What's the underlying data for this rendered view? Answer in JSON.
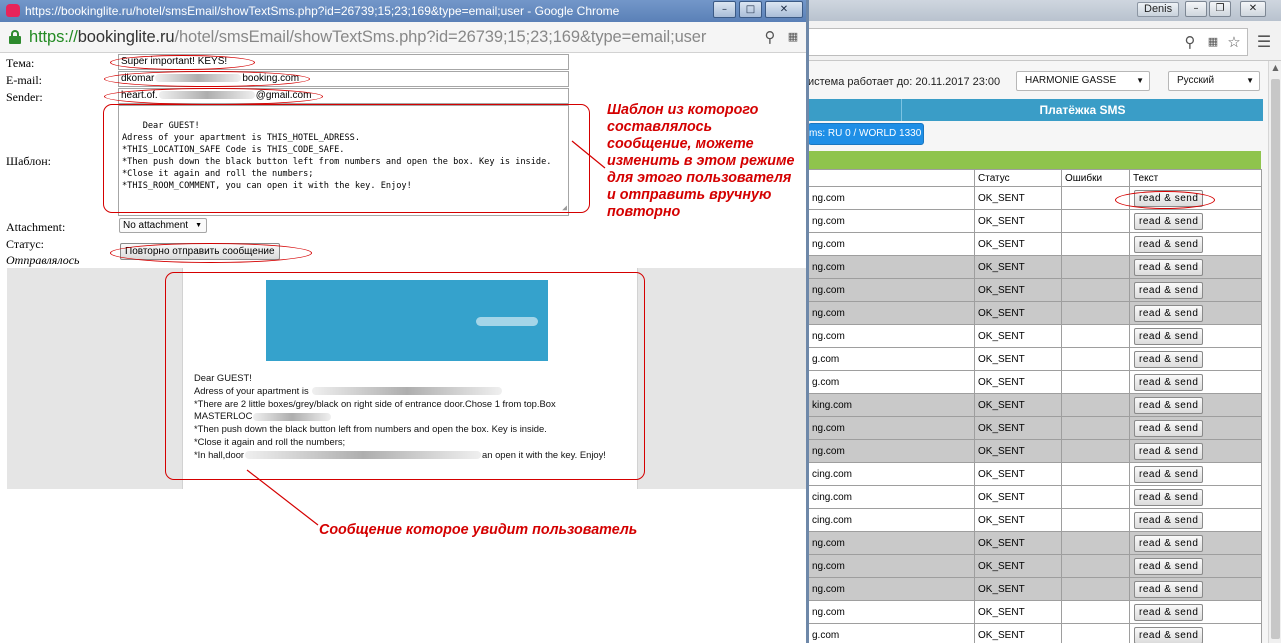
{
  "background_window": {
    "user_badge": "Denis",
    "system_status": "истема работает до: 20.11.2017 23:00",
    "hotel_select": "HARMONIE GASSE",
    "language_select": "Русский",
    "tab_title": "Платёжка SMS",
    "sms_button": "ms: RU 0 / WORLD 1330",
    "table": {
      "headers": [
        "",
        "Статус",
        "Ошибки",
        "Текст"
      ],
      "rows": [
        {
          "email": "ng.com",
          "status": "OK_SENT",
          "action": "read & send"
        },
        {
          "email": "ng.com",
          "status": "OK_SENT",
          "action": "read & send"
        },
        {
          "email": "ng.com",
          "status": "OK_SENT",
          "action": "read & send"
        },
        {
          "email": "ng.com",
          "status": "OK_SENT",
          "action": "read & send"
        },
        {
          "email": "ng.com",
          "status": "OK_SENT",
          "action": "read & send"
        },
        {
          "email": "ng.com",
          "status": "OK_SENT",
          "action": "read & send"
        },
        {
          "email": "ng.com",
          "status": "OK_SENT",
          "action": "read & send"
        },
        {
          "email": "g.com",
          "status": "OK_SENT",
          "action": "read & send"
        },
        {
          "email": "g.com",
          "status": "OK_SENT",
          "action": "read & send"
        },
        {
          "email": "king.com",
          "status": "OK_SENT",
          "action": "read & send"
        },
        {
          "email": "ng.com",
          "status": "OK_SENT",
          "action": "read & send"
        },
        {
          "email": "ng.com",
          "status": "OK_SENT",
          "action": "read & send"
        },
        {
          "email": "cing.com",
          "status": "OK_SENT",
          "action": "read & send"
        },
        {
          "email": "cing.com",
          "status": "OK_SENT",
          "action": "read & send"
        },
        {
          "email": "cing.com",
          "status": "OK_SENT",
          "action": "read & send"
        },
        {
          "email": "ng.com",
          "status": "OK_SENT",
          "action": "read & send"
        },
        {
          "email": "ng.com",
          "status": "OK_SENT",
          "action": "read & send"
        },
        {
          "email": "ng.com",
          "status": "OK_SENT",
          "action": "read & send"
        },
        {
          "email": "ng.com",
          "status": "OK_SENT",
          "action": "read & send"
        },
        {
          "email": "g.com",
          "status": "OK_SENT",
          "action": "read & send"
        }
      ],
      "row_shading": [
        "white",
        "white",
        "white",
        "grey",
        "grey",
        "grey",
        "white",
        "white",
        "white",
        "grey",
        "grey",
        "grey",
        "white",
        "white",
        "white",
        "grey",
        "grey",
        "grey",
        "white",
        "white"
      ]
    }
  },
  "popup": {
    "title": "https://bookinglite.ru/hotel/smsEmail/showTextSms.php?id=26739;15;23;169&type=email;user - Google Chrome",
    "url_protocol": "https://",
    "url_host": "bookinglite.ru",
    "url_path": "/hotel/smsEmail/showTextSms.php?id=26739;15;23;169&type=email;user",
    "form": {
      "subject_label": "Тема:",
      "subject_value": "Super important! KEYS!",
      "email_label": "E-mail:",
      "email_prefix": "dkomar",
      "email_suffix": "booking.com",
      "sender_label": "Sender:",
      "sender_prefix": "heart.of.",
      "sender_suffix": "@gmail.com",
      "template_label": "Шаблон:",
      "template_text": "Dear GUEST!\nAdress of your apartment is THIS_HOTEL_ADRESS.\n*THIS_LOCATION_SAFE Code is THIS_CODE_SAFE.\n*Then push down the black button left from numbers and open the box. Key is inside.\n*Close it again and roll the numbers;\n*THIS_ROOM_COMMENT, you can open it with the key. Enjoy!",
      "attachment_label": "Attachment:",
      "attachment_value": "No attachment",
      "status_label": "Статус:",
      "status_value": "Отправлялось",
      "resend_button": "Повторно отправить сообщение"
    },
    "preview": {
      "lines": [
        "Dear GUEST!",
        "Adress of your apartment is",
        "*There are 2 little boxes/grey/black on right side of entrance door.Chose 1 from top.Box",
        "MASTERLOC",
        "*Then push down the black button left from numbers and open the box. Key is inside.",
        "*Close it again and roll the numbers;",
        "*In hall,door",
        "an open it with the key. Enjoy!"
      ]
    }
  },
  "annotations": {
    "template_note": [
      "Шаблон из которого",
      "составлялось",
      "сообщение, можете",
      "изменить в этом режиме",
      "для этого пользователя",
      "и отправить вручную",
      "повторно"
    ],
    "message_note": "Сообщение которое увидит пользователь"
  },
  "colors": {
    "annotation_red": "#d40000",
    "popup_titlebar": "#6387bd",
    "blue_bar": "#3a9dc7",
    "green_bar": "#8fc44d",
    "sms_button": "#1f8fe6",
    "banner": "#35a2cc"
  }
}
